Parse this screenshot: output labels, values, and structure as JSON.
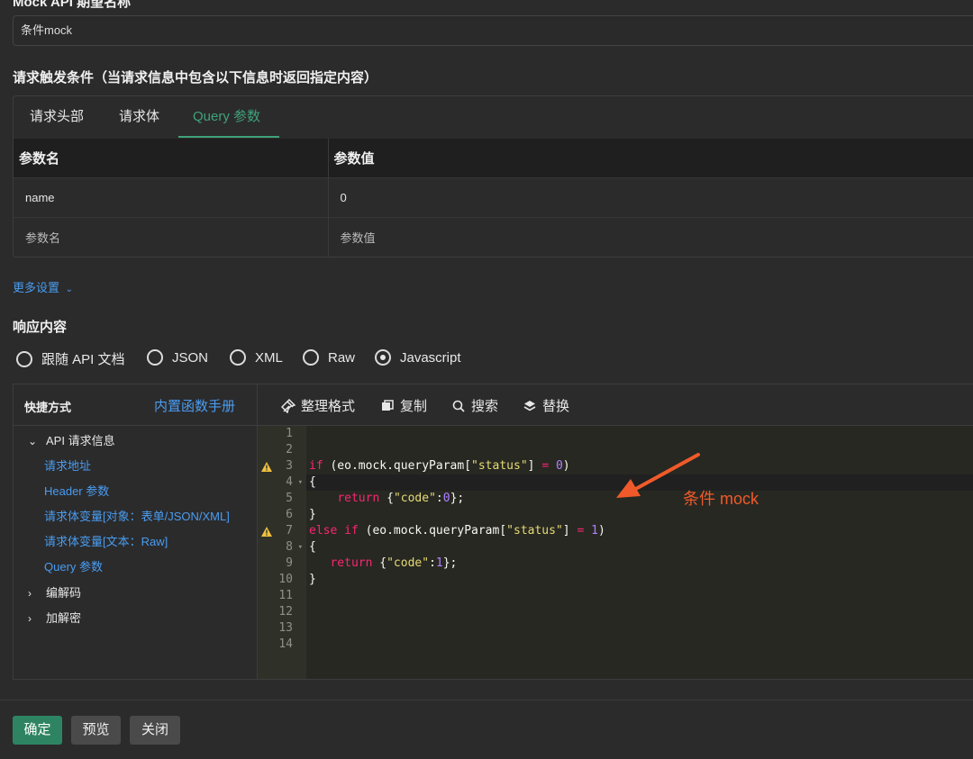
{
  "form": {
    "top_label": "Mock API 期望名称",
    "name_value": "条件mock",
    "trigger_title": "请求触发条件（当请求信息中包含以下信息时返回指定内容）"
  },
  "trigger_tabs": [
    {
      "label": "请求头部"
    },
    {
      "label": "请求体"
    },
    {
      "label": "Query 参数",
      "active": true
    }
  ],
  "params_table": {
    "headers": [
      "参数名",
      "参数值"
    ],
    "rows": [
      {
        "name": "name",
        "value": "0"
      },
      {
        "name": "参数名",
        "value": "参数值",
        "placeholder": true
      }
    ]
  },
  "more_settings": "更多设置",
  "response": {
    "title": "响应内容",
    "options": [
      "跟随 API 文档",
      "JSON",
      "XML",
      "Raw",
      "Javascript"
    ],
    "selected": "Javascript"
  },
  "shortcuts": {
    "title": "快捷方式",
    "manual_link": "内置函数手册",
    "groups": [
      {
        "label": "API 请求信息",
        "expanded": true,
        "items": [
          "请求地址",
          "Header 参数",
          "请求体变量[对象：表单/JSON/XML]",
          "请求体变量[文本：Raw]",
          "Query 参数"
        ]
      },
      {
        "label": "编解码",
        "expanded": false
      },
      {
        "label": "加解密",
        "expanded": false
      }
    ]
  },
  "toolbar": {
    "format": "整理格式",
    "copy": "复制",
    "search": "搜索",
    "replace": "替换"
  },
  "code": {
    "line_numbers": [
      "1",
      "2",
      "3",
      "4",
      "5",
      "6",
      "7",
      "8",
      "9",
      "10",
      "11",
      "12",
      "13",
      "14"
    ],
    "warning_lines": [
      3,
      7
    ],
    "fold_lines": [
      4,
      8
    ],
    "active_line": 4,
    "lines": [
      "",
      "",
      "if (eo.mock.queryParam[\"status\"] = 0)",
      "{",
      "    return {\"code\":0};",
      "}",
      "else if (eo.mock.queryParam[\"status\"] = 1)",
      "{",
      "   return {\"code\":1};",
      "}",
      "",
      "",
      "",
      ""
    ]
  },
  "annotation": {
    "text": "条件 mock",
    "color": "#f05a2a"
  },
  "buttons": {
    "confirm": "确定",
    "preview": "预览",
    "close": "关闭"
  },
  "colors": {
    "accent": "#3fa27a",
    "link": "#4a9cf0",
    "primary_button": "#2e8462"
  }
}
